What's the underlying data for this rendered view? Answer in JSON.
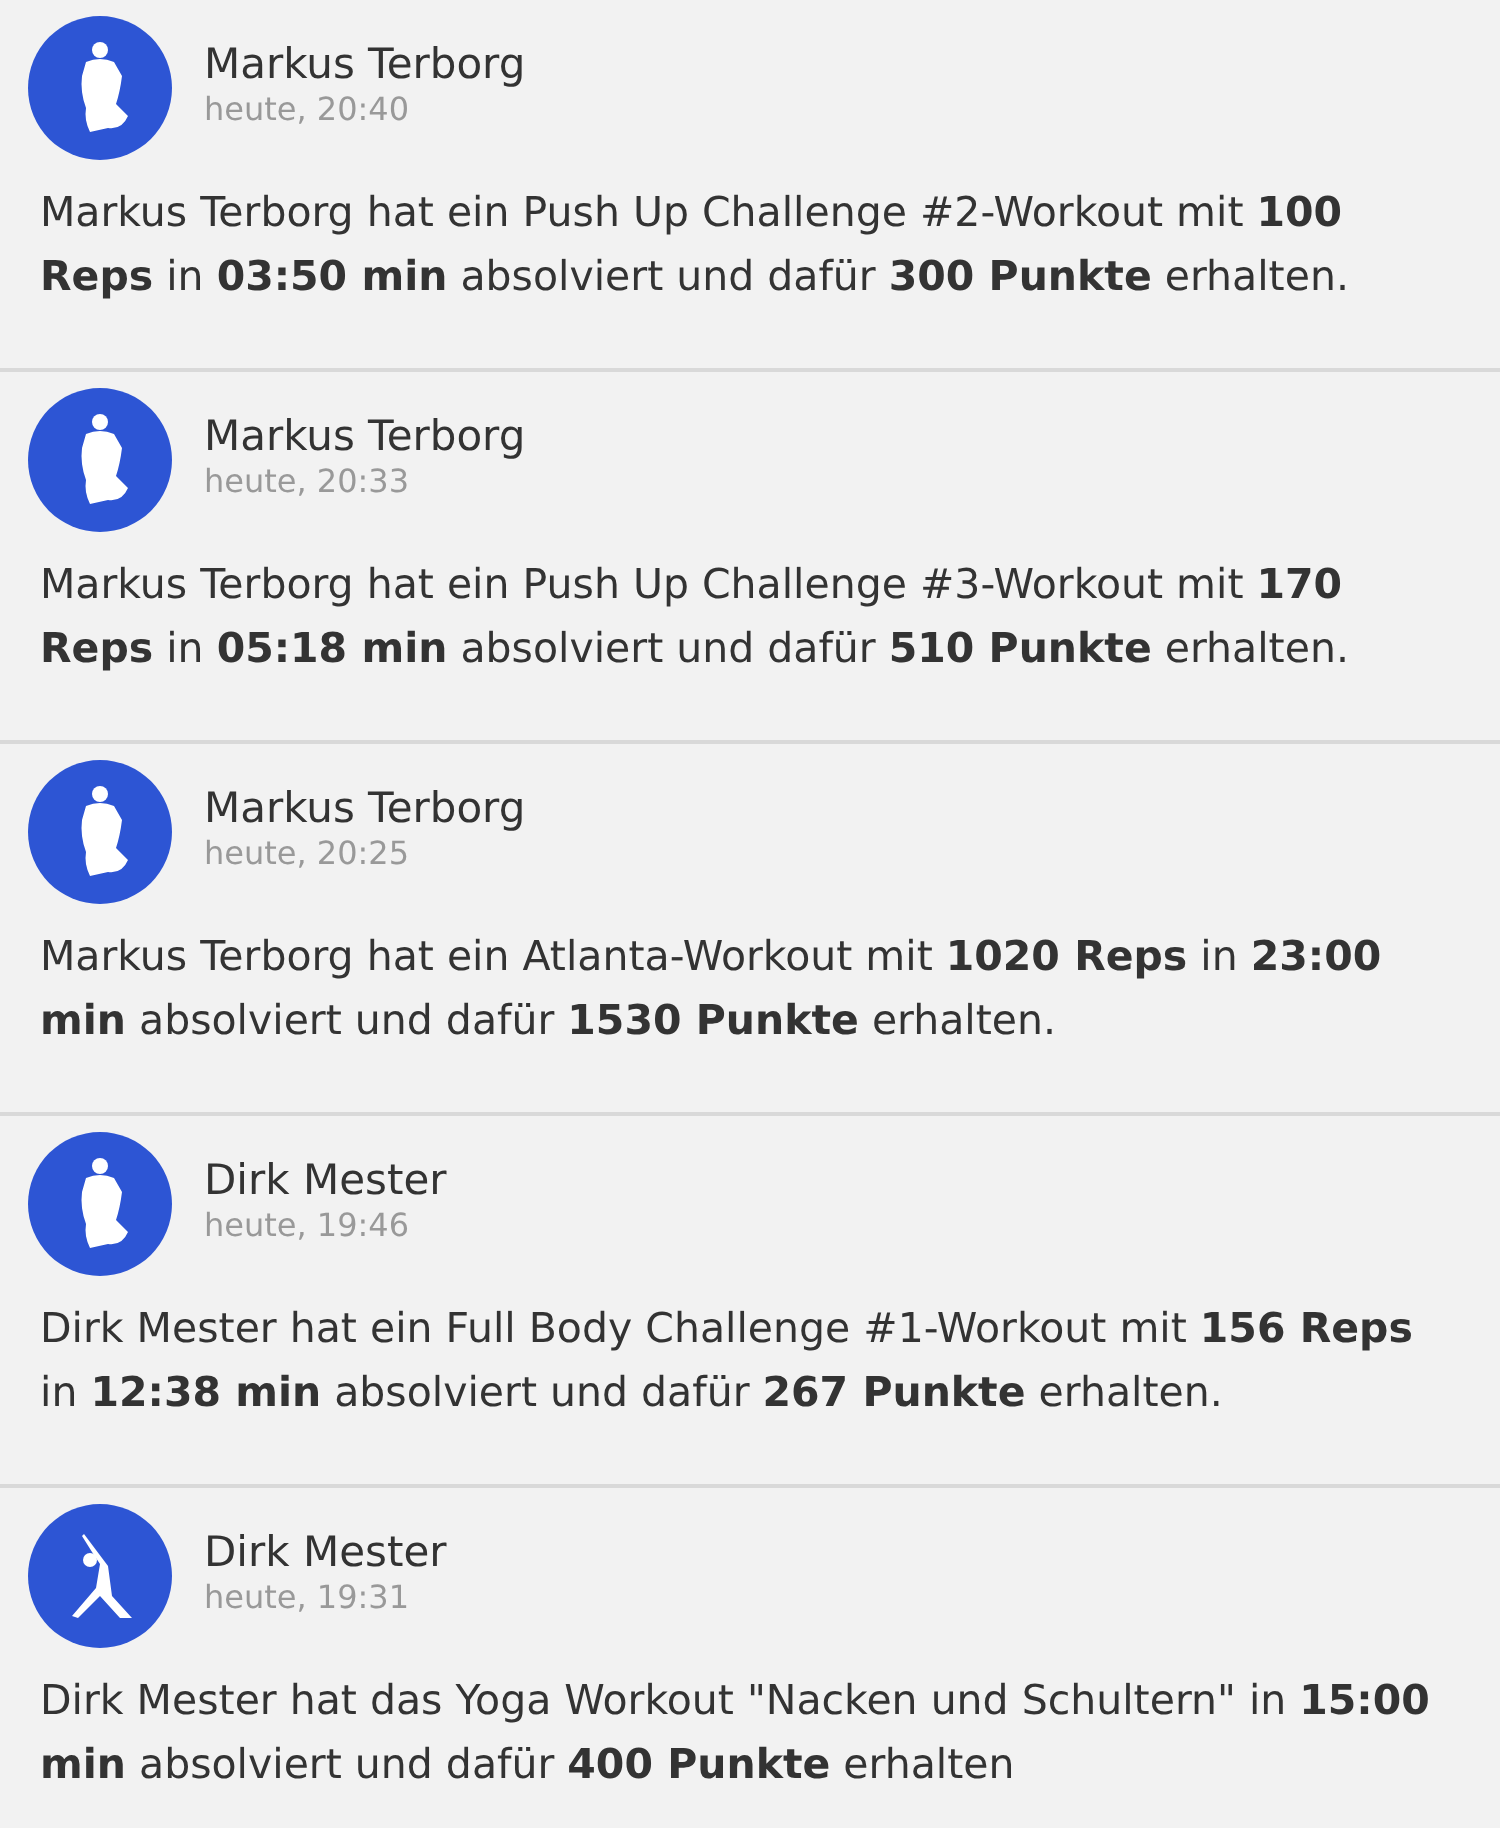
{
  "feed": [
    {
      "author": "Markus Terborg",
      "time": "heute, 20:40",
      "kind": "torso",
      "message": "Markus Terborg hat ein Push Up Challenge #2-Workout mit **100 Reps** in **03:50 min** absolviert und dafür **300 Punkte** erhalten."
    },
    {
      "author": "Markus Terborg",
      "time": "heute, 20:33",
      "kind": "torso",
      "message": "Markus Terborg hat ein Push Up Challenge #3-Workout mit **170 Reps** in **05:18 min** absolviert und dafür **510 Punkte** erhalten."
    },
    {
      "author": "Markus Terborg",
      "time": "heute, 20:25",
      "kind": "torso",
      "message": "Markus Terborg hat ein Atlanta-Workout mit **1020 Reps** in **23:00 min** absolviert und dafür **1530 Punkte** erhalten."
    },
    {
      "author": "Dirk Mester",
      "time": "heute, 19:46",
      "kind": "torso",
      "message": "Dirk Mester hat ein Full Body Challenge #1-Workout mit **156 Reps** in **12:38 min** absolviert und dafür **267 Punkte** erhalten."
    },
    {
      "author": "Dirk Mester",
      "time": "heute, 19:31",
      "kind": "yoga",
      "message": "Dirk Mester hat das Yoga Workout \"Nacken und Schultern\" in **15:00 min** absolviert und dafür **400 Punkte** erhalten"
    }
  ]
}
